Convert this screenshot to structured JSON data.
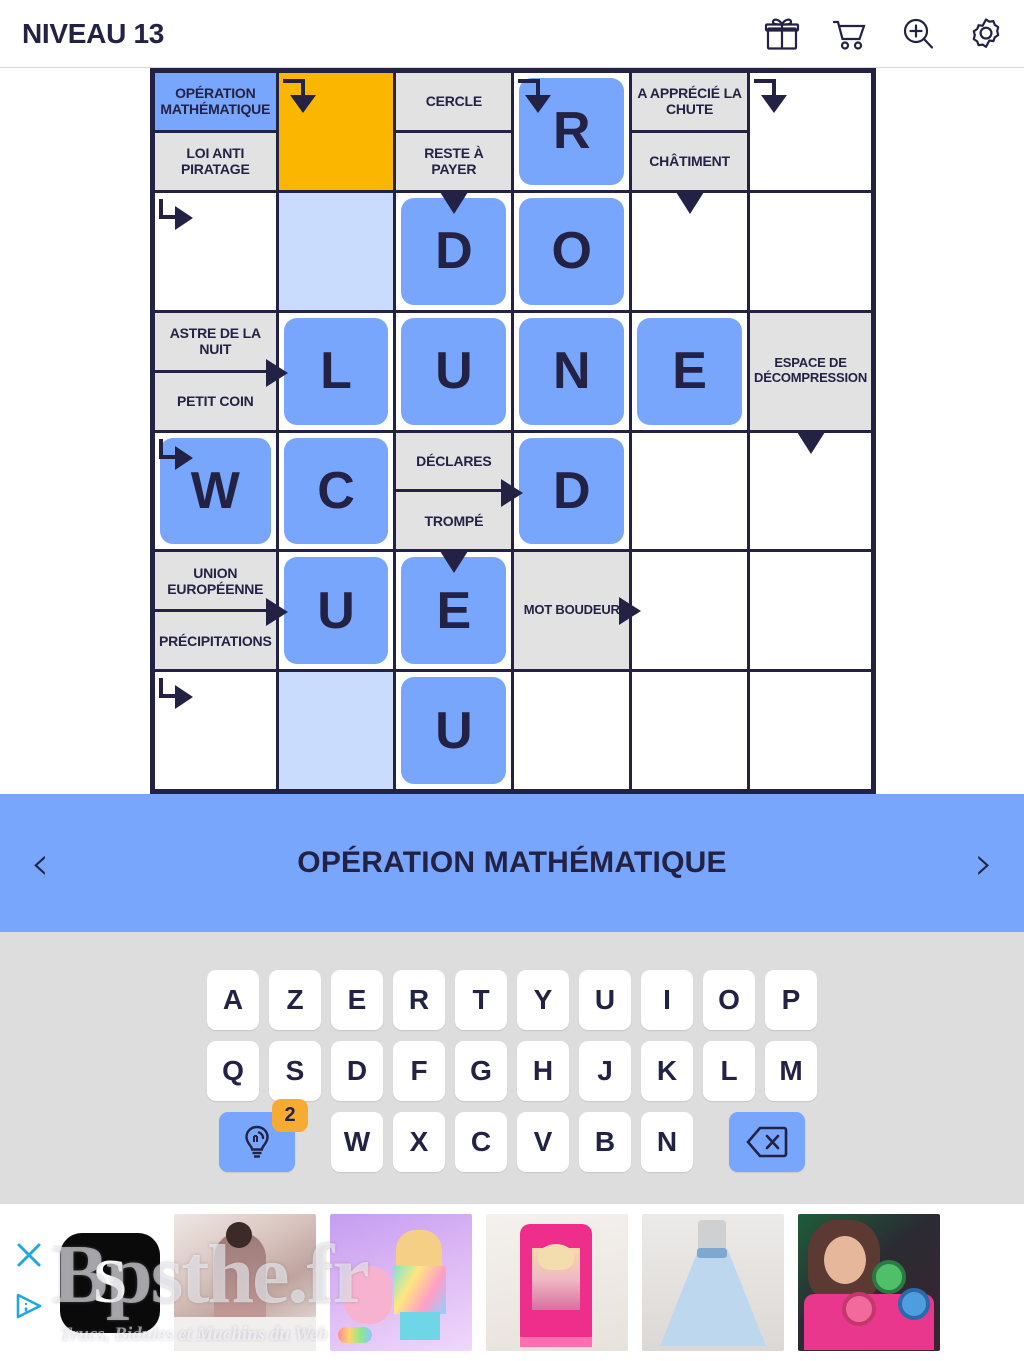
{
  "header": {
    "level_title": "NIVEAU 13",
    "icons": [
      {
        "name": "gift-icon",
        "label": "gift"
      },
      {
        "name": "cart-icon",
        "label": "shop"
      },
      {
        "name": "zoom-in-icon",
        "label": "zoom"
      },
      {
        "name": "gear-icon",
        "label": "settings"
      }
    ]
  },
  "colors": {
    "accent_blue": "#78a6fc",
    "active_cell": "#fbb700",
    "highlight_col": "#c9dcfd",
    "clue_bg": "#e2e2e2",
    "ink": "#242244",
    "badge_orange": "#f8ab33",
    "keyboard_bg": "#dddddd"
  },
  "grid": {
    "rows": 6,
    "cols": 6,
    "cells": [
      [
        {
          "type": "clue",
          "clues": [
            "OPÉRATION MATHÉMATIQUE",
            "LOI ANTI PIRATAGE"
          ],
          "selected_index": 0
        },
        {
          "type": "active",
          "arrow": "hook-down"
        },
        {
          "type": "clue",
          "clues": [
            "CERCLE",
            "RESTE À PAYER"
          ]
        },
        {
          "type": "letter",
          "letter": "R",
          "arrow": "hook-down"
        },
        {
          "type": "clue",
          "clues": [
            "A APPRÉCIÉ LA CHUTE",
            "CHÂTIMENT"
          ]
        },
        {
          "type": "empty",
          "arrow": "hook-down"
        }
      ],
      [
        {
          "type": "empty",
          "arrow": "hook-right"
        },
        {
          "type": "highlight"
        },
        {
          "type": "letter",
          "letter": "D",
          "arrow": "down-plain"
        },
        {
          "type": "letter",
          "letter": "O"
        },
        {
          "type": "empty",
          "arrow": "down-plain"
        },
        {
          "type": "empty"
        }
      ],
      [
        {
          "type": "clue",
          "clues": [
            "ASTRE DE LA NUIT",
            "PETIT COIN"
          ],
          "arrow": "right-mid"
        },
        {
          "type": "letter",
          "letter": "L"
        },
        {
          "type": "letter",
          "letter": "U"
        },
        {
          "type": "letter",
          "letter": "N"
        },
        {
          "type": "letter",
          "letter": "E"
        },
        {
          "type": "clue",
          "clues": [
            "ESPACE DE DÉCOMPRESSION"
          ],
          "single": true
        }
      ],
      [
        {
          "type": "letter",
          "letter": "W",
          "arrow": "hook-right"
        },
        {
          "type": "letter",
          "letter": "C"
        },
        {
          "type": "clue",
          "clues": [
            "DÉCLARES",
            "TROMPÉ"
          ],
          "arrow": "right-mid"
        },
        {
          "type": "letter",
          "letter": "D"
        },
        {
          "type": "empty"
        },
        {
          "type": "empty",
          "arrow": "down-plain"
        }
      ],
      [
        {
          "type": "clue",
          "clues": [
            "UNION EUROPÉENNE",
            "PRÉCIPITATIONS"
          ],
          "arrow": "right-mid"
        },
        {
          "type": "letter",
          "letter": "U"
        },
        {
          "type": "letter",
          "letter": "E",
          "arrow": "down-plain"
        },
        {
          "type": "clue",
          "clues": [
            "MOT BOUDEUR"
          ],
          "single": true,
          "arrow": "right-edge"
        },
        {
          "type": "empty"
        },
        {
          "type": "empty"
        }
      ],
      [
        {
          "type": "empty",
          "arrow": "hook-right"
        },
        {
          "type": "highlight"
        },
        {
          "type": "letter",
          "letter": "U"
        },
        {
          "type": "empty"
        },
        {
          "type": "empty"
        },
        {
          "type": "empty"
        }
      ]
    ]
  },
  "cluebar": {
    "prev_label": "‹",
    "text": "OPÉRATION MATHÉMATIQUE",
    "next_label": "›"
  },
  "keyboard": {
    "rows": [
      [
        "A",
        "Z",
        "E",
        "R",
        "T",
        "Y",
        "U",
        "I",
        "O",
        "P"
      ],
      [
        "Q",
        "S",
        "D",
        "F",
        "G",
        "H",
        "J",
        "K",
        "L",
        "M"
      ],
      [
        "W",
        "X",
        "C",
        "V",
        "B",
        "N"
      ]
    ],
    "hint_badge": "2",
    "hint_icon": "lightbulb-icon",
    "backspace_icon": "backspace-icon"
  },
  "ad": {
    "close_icon": "close-icon",
    "info_icon": "ad-info-icon",
    "logo_text": "S",
    "watermark_main": "Bpsthe.fr",
    "watermark_sub": "Trucs, Bidules et Machins du Web"
  }
}
